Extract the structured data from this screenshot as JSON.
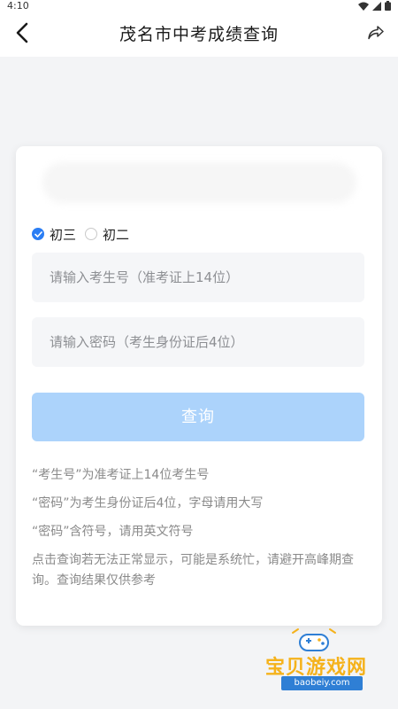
{
  "status_bar": {
    "time": "4:10"
  },
  "nav": {
    "title": "茂名市中考成绩查询"
  },
  "form": {
    "grade_options": [
      {
        "label": "初三",
        "checked": true
      },
      {
        "label": "初二",
        "checked": false
      }
    ],
    "exam_number": {
      "placeholder": "请输入考生号（准考证上14位）",
      "value": ""
    },
    "password": {
      "placeholder": "请输入密码（考生身份证后4位）",
      "value": ""
    },
    "query_label": "查询"
  },
  "notes": [
    "“考生号”为准考证上14位考生号",
    "“密码”为考生身份证后4位，字母请用大写",
    "“密码”含符号，请用英文符号",
    "点击查询若无法正常显示，可能是系统忙，请避开高峰期查询。查询结果仅供参考"
  ],
  "watermark": {
    "title": "宝贝游戏网",
    "url": "baobeiy.com"
  },
  "colors": {
    "accent": "#2a7df4",
    "button_disabled": "#acd3fb",
    "watermark_gold": "#f5b21b",
    "watermark_blue": "#2f7fd5"
  },
  "icons": {
    "back": "chevron-left-icon",
    "share": "share-icon",
    "wifi": "wifi-icon",
    "signal": "signal-icon",
    "battery": "battery-icon"
  }
}
